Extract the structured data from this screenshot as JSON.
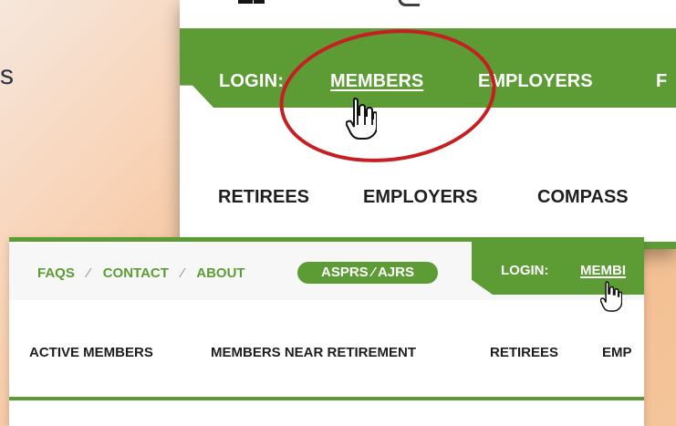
{
  "background": {
    "partial_text": "s"
  },
  "zoom": {
    "top_partial": "",
    "nav": {
      "login": "LOGIN:",
      "members": "MEMBERS",
      "employers": "EMPLOYERS",
      "last_letter": "F"
    },
    "subnav": {
      "retirees": "RETIREES",
      "employers": "EMPLOYERS",
      "compass": "COMPASS"
    }
  },
  "screen": {
    "top_links": {
      "faqs": "FAQS",
      "separator_1": "⁄",
      "contact": "CONTACT",
      "separator_2": "⁄",
      "about": "ABOUT",
      "asprs": "ASPRS ⁄ AJRS"
    },
    "login_nav": {
      "login": "LOGIN:",
      "members": "MEMBI"
    },
    "subnav": {
      "active_members": "ACTIVE MEMBERS",
      "members_near_retirement": "MEMBERS NEAR RETIREMENT",
      "retirees": "RETIREES",
      "emp": "EMP"
    }
  },
  "colors": {
    "green": "#5d9b35",
    "red": "#c61f23",
    "text_dark": "#1f1f1f",
    "white": "#ffffff"
  },
  "icons": {
    "cursor": "hand-pointer-icon"
  }
}
